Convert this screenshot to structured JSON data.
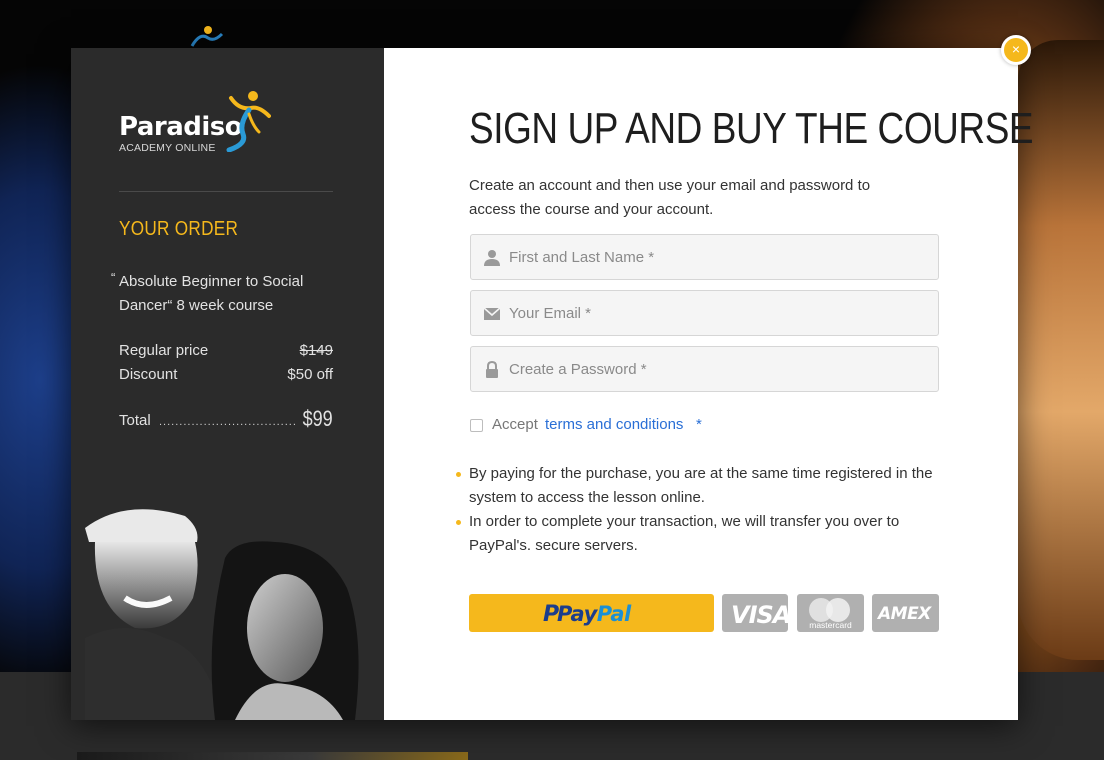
{
  "brand": {
    "name": "Paradiso",
    "tagline": "ACADEMY ONLINE",
    "accent": "#f5b81c"
  },
  "order": {
    "title": "YOUR ORDER",
    "course_quote": "“",
    "course_name": "Absolute Beginner to Social Dancer“ 8 week course",
    "regular_label": "Regular price",
    "regular_value": "$149",
    "discount_label": "Discount",
    "discount_value": "$50 off",
    "total_label": "Total",
    "total_value": "$99"
  },
  "signup": {
    "heading": "SIGN UP AND BUY THE COURSE",
    "intro": "Create an account and then use your email and password to access the course and your account.",
    "name_placeholder": "First and Last Name *",
    "email_placeholder": "Your Email *",
    "password_placeholder": "Create a Password *",
    "accept_label": "Accept",
    "terms_link": "terms and conditions",
    "terms_required": "*",
    "bullets": [
      "By paying for the purchase, you are at the same time registered in the system to access the lesson online.",
      "In order to complete your transaction, we will transfer you over to PayPal's.  secure servers."
    ]
  },
  "payment": {
    "paypal_p": "P",
    "paypal_a": "Pay",
    "paypal_b": "Pal",
    "visa": "VISA",
    "mastercard": "mastercard",
    "amex": "AMEX"
  },
  "close_label": "×"
}
